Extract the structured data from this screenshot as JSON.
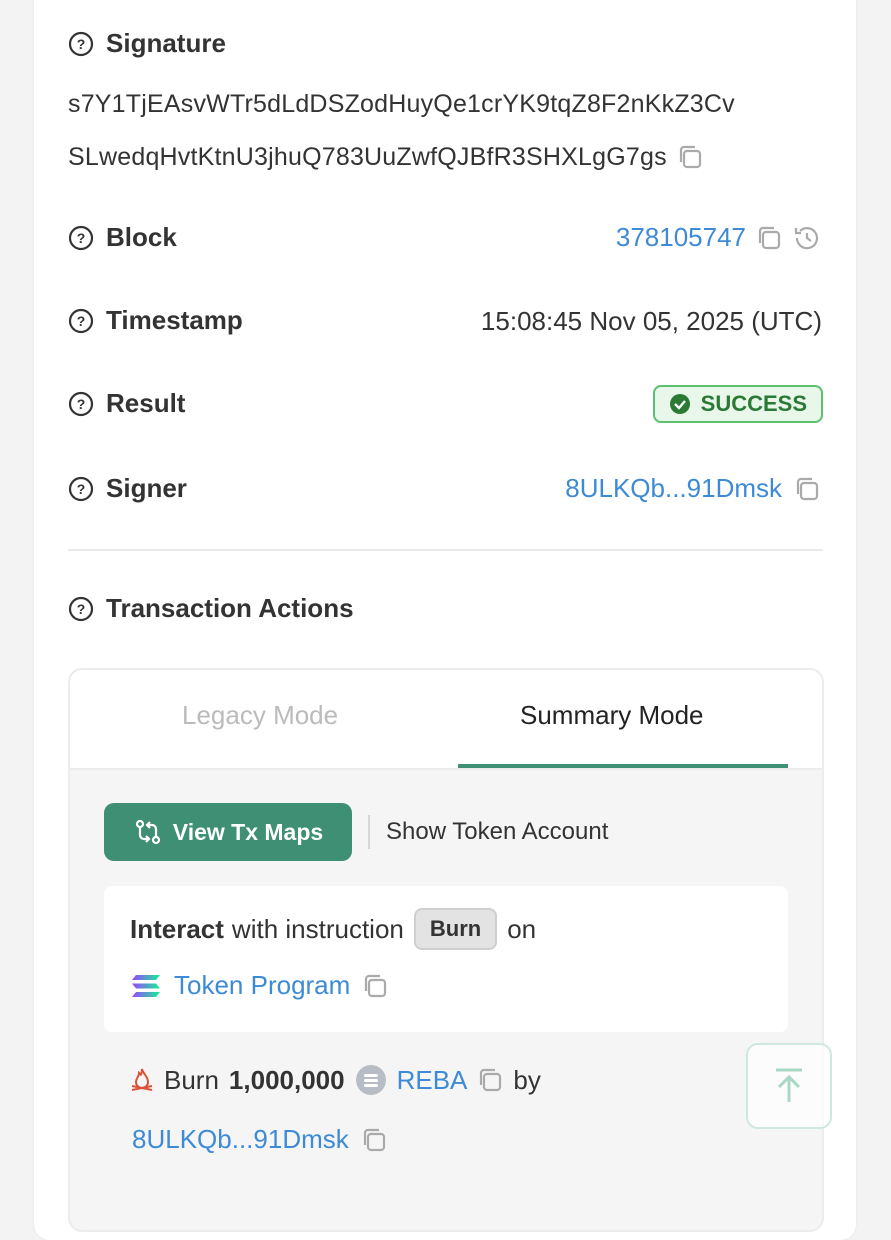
{
  "signature": {
    "label": "Signature",
    "line1": "s7Y1TjEAsvWTr5dLdDSZodHuyQe1crYK9tqZ8F2nKkZ3Cv",
    "line2": "SLwedqHvtKtnU3jhuQ783UuZwfQJBfR3SHXLgG7gs"
  },
  "block": {
    "label": "Block",
    "value": "378105747"
  },
  "timestamp": {
    "label": "Timestamp",
    "value": "15:08:45 Nov 05, 2025 (UTC)"
  },
  "result": {
    "label": "Result",
    "value": "SUCCESS"
  },
  "signer": {
    "label": "Signer",
    "value": "8ULKQb...91Dmsk"
  },
  "actions": {
    "label": "Transaction Actions",
    "tabs": [
      {
        "label": "Legacy Mode",
        "active": false
      },
      {
        "label": "Summary Mode",
        "active": true
      }
    ],
    "view_tx_maps": "View Tx Maps",
    "show_token_account": "Show Token Account",
    "instruction": {
      "interact": "Interact",
      "with_instruction": "with instruction",
      "name": "Burn",
      "on": "on",
      "program": "Token Program"
    },
    "burn": {
      "verb": "Burn",
      "amount": "1,000,000",
      "token": "REBA",
      "by": "by",
      "account": "8ULKQb...91Dmsk"
    }
  },
  "colors": {
    "link": "#3d8ad6",
    "accent": "#3f8f74",
    "success_border": "#5cc06d",
    "success_text": "#2a7a36"
  },
  "icons": [
    "question-circle-icon",
    "copy-icon",
    "history-icon",
    "check-circle-icon",
    "swap-arrows-icon",
    "solana-logo-icon",
    "fire-icon",
    "reba-token-icon",
    "arrow-up-icon"
  ]
}
